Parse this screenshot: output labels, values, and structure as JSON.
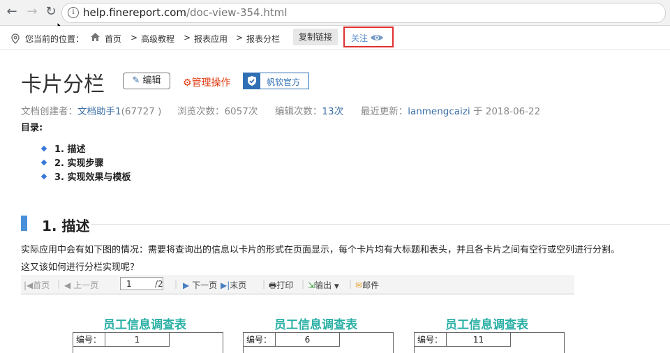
{
  "browser": {
    "url_host": "help.finereport.com",
    "url_path": "/doc-view-354.html"
  },
  "breadcrumb": {
    "prefix": "您当前的位置：",
    "items": [
      "首页",
      "高级教程",
      "报表应用",
      "报表分栏"
    ],
    "separator": ">",
    "copy_label": "复制链接",
    "follow_label": "关注"
  },
  "article": {
    "title": "卡片分栏",
    "edit_label": "编辑",
    "manage_label": "管理操作",
    "official_label": "帆软官方",
    "creator_label": "文档创建者：",
    "creator_name": "文档助手1",
    "creator_id": "(67727 )",
    "views_label": "浏览次数：",
    "views_value": "6057次",
    "edits_label": "编辑次数：",
    "edits_value": "13次",
    "updated_label": "最近更新：",
    "updated_user": "lanmengcaizi",
    "updated_on": "于",
    "updated_date": "2018-06-22",
    "toc_label": "目录:",
    "toc": [
      "1. 描述",
      "2. 实现步骤",
      "3. 实现效果与模板"
    ],
    "section_title": "1. 描述",
    "para_1": "实际应用中会有如下图的情况：需要将查询出的信息以卡片的形式在页面显示，每个卡片均有大标题和表头，并且各卡片之间有空行或空列进行分割。",
    "para_2": "这又该如何进行分栏实现呢？"
  },
  "report_toolbar": {
    "first": "首页",
    "prev": "上一页",
    "page_value": "1",
    "page_total": "/2",
    "next": "下一页",
    "last": "末页",
    "print": "打印",
    "export": "输出",
    "mail": "邮件"
  },
  "cards": [
    {
      "title": "员工信息调查表",
      "id_label": "编号：",
      "id_value": "1"
    },
    {
      "title": "员工信息调查表",
      "id_label": "编号：",
      "id_value": "6"
    },
    {
      "title": "员工信息调查表",
      "id_label": "编号：",
      "id_value": "11"
    }
  ],
  "colors": {
    "link": "#3a6ea5",
    "manage": "#e03a10",
    "official": "#2f6fb4",
    "card_title": "#2bb0a6",
    "section_bar": "#4a90d9"
  }
}
